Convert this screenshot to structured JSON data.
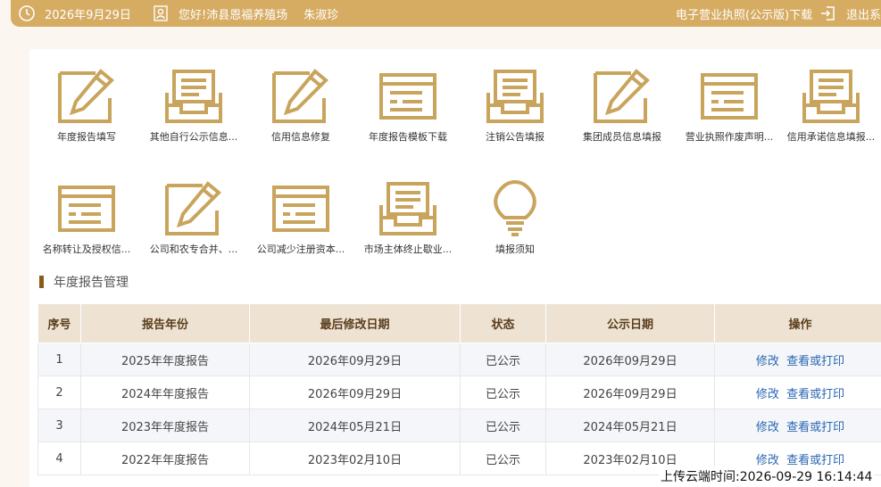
{
  "header": {
    "date": "2026年9月29日",
    "greeting": "您好!沛县恩福养殖场",
    "user": "朱淑珍",
    "license_link": "电子营业执照(公示版)下载",
    "logout": "退出系"
  },
  "tiles_row1": [
    {
      "label": "年度报告填写",
      "icon": "edit-icon"
    },
    {
      "label": "其他自行公示信息...",
      "icon": "inbox-icon"
    },
    {
      "label": "信用信息修复",
      "icon": "edit-icon"
    },
    {
      "label": "年度报告模板下载",
      "icon": "form-icon"
    },
    {
      "label": "注销公告填报",
      "icon": "inbox-icon"
    },
    {
      "label": "集团成员信息填报",
      "icon": "edit-icon"
    },
    {
      "label": "营业执照作废声明...",
      "icon": "form-icon"
    },
    {
      "label": "信用承诺信息填报...",
      "icon": "inbox-icon"
    }
  ],
  "tiles_row2": [
    {
      "label": "名称转让及授权信...",
      "icon": "form-icon"
    },
    {
      "label": "公司和农专合并、...",
      "icon": "edit-icon"
    },
    {
      "label": "公司减少注册资本...",
      "icon": "form-icon"
    },
    {
      "label": "市场主体终止歇业...",
      "icon": "inbox-icon"
    },
    {
      "label": "填报须知",
      "icon": "lightbulb-icon"
    }
  ],
  "section": {
    "title": "年度报告管理"
  },
  "table": {
    "headers": [
      "序号",
      "报告年份",
      "最后修改日期",
      "状态",
      "公示日期",
      "操作"
    ],
    "rows": [
      {
        "no": "1",
        "year": "2025年年度报告",
        "modified": "2026年09月29日",
        "status": "已公示",
        "public_date": "2026年09月29日",
        "edit": "修改",
        "view": "查看或打印"
      },
      {
        "no": "2",
        "year": "2024年年度报告",
        "modified": "2026年09月29日",
        "status": "已公示",
        "public_date": "2026年09月29日",
        "edit": "修改",
        "view": "查看或打印"
      },
      {
        "no": "3",
        "year": "2023年年度报告",
        "modified": "2024年05月21日",
        "status": "已公示",
        "public_date": "2024年05月21日",
        "edit": "修改",
        "view": "查看或打印"
      },
      {
        "no": "4",
        "year": "2022年年度报告",
        "modified": "2023年02月10日",
        "status": "已公示",
        "public_date": "2023年02月10日",
        "edit": "修改",
        "view": "查看或打印"
      }
    ]
  },
  "overlay": {
    "upload_time": "上传云端时间:2026-09-29 16:14:44"
  },
  "colors": {
    "accent": "#d6ac63",
    "icon_gold": "#c9a45c",
    "link": "#2a66b2",
    "header_bg": "#eee2d3"
  }
}
